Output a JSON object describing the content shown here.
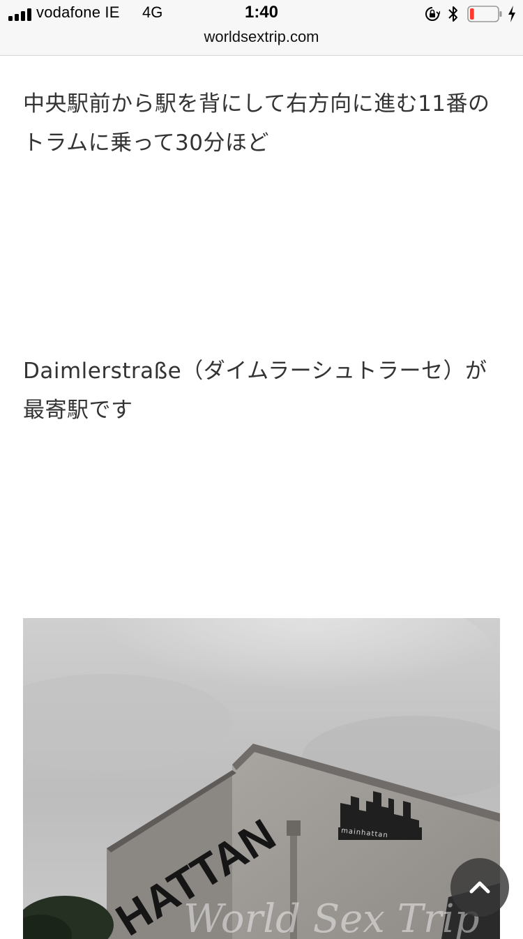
{
  "status_bar": {
    "carrier": "vodafone IE",
    "network": "4G",
    "time": "1:40",
    "url": "worldsextrip.com",
    "icons": [
      "signal-icon",
      "rotation-lock-icon",
      "bluetooth-icon",
      "battery-icon",
      "charging-bolt-icon"
    ],
    "battery_level": 0.15,
    "battery_color": "#ff3b30"
  },
  "article": {
    "para1": "中央駅前から駅を背にして右方向に進む11番のトラムに乗って30分ほど",
    "para2": "Daimlerstraße（ダイムラーシュトラーセ）が最寄駅です"
  },
  "photo": {
    "sign_text": "mainhattan",
    "facade_text": "HATTAN",
    "watermark": "World Sex Trip"
  },
  "scroll_top_button": {
    "icon": "chevron-up-icon"
  }
}
